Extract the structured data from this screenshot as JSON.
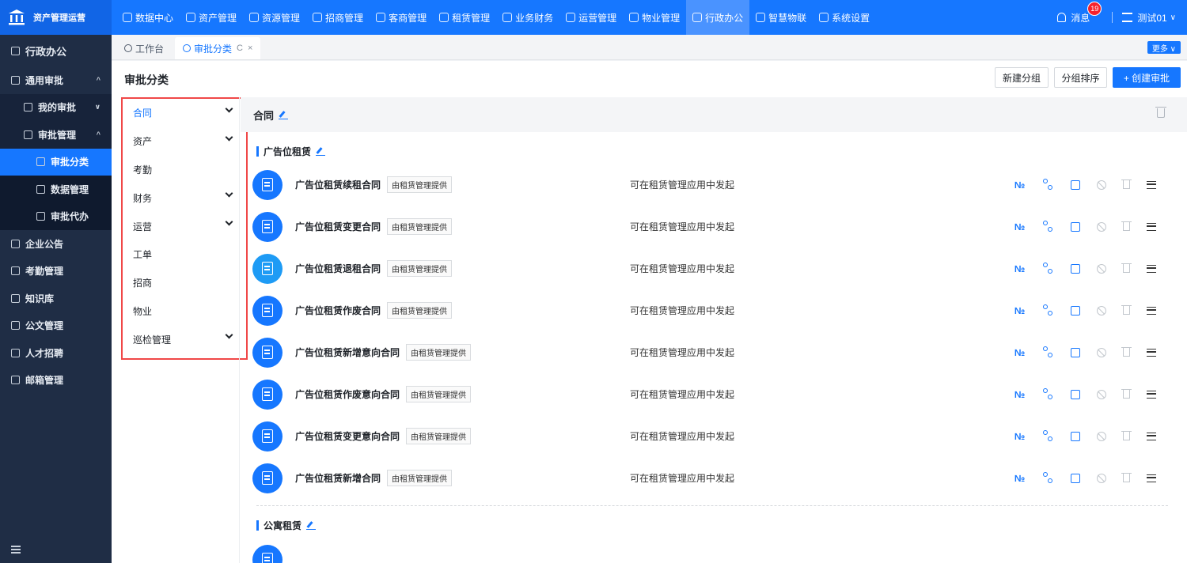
{
  "app": {
    "brand": "资产管理运营"
  },
  "topnav": [
    {
      "label": "数据中心",
      "active": false
    },
    {
      "label": "资产管理",
      "active": false
    },
    {
      "label": "资源管理",
      "active": false
    },
    {
      "label": "招商管理",
      "active": false
    },
    {
      "label": "客商管理",
      "active": false
    },
    {
      "label": "租赁管理",
      "active": false
    },
    {
      "label": "业务财务",
      "active": false
    },
    {
      "label": "运营管理",
      "active": false
    },
    {
      "label": "物业管理",
      "active": false
    },
    {
      "label": "行政办公",
      "active": true
    },
    {
      "label": "智慧物联",
      "active": false
    },
    {
      "label": "系统设置",
      "active": false
    }
  ],
  "header": {
    "messages_label": "消息",
    "messages_count": "19",
    "user_name": "测试01",
    "user_caret": "∨"
  },
  "sidebar": {
    "title": "行政办公",
    "items": [
      {
        "label": "通用审批",
        "level": 0,
        "arrow": "^"
      },
      {
        "label": "我的审批",
        "level": 1,
        "arrow": "∨"
      },
      {
        "label": "审批管理",
        "level": 1,
        "arrow": "^"
      },
      {
        "label": "审批分类",
        "level": 2,
        "selected": true
      },
      {
        "label": "数据管理",
        "level": 2
      },
      {
        "label": "审批代办",
        "level": 2
      },
      {
        "label": "企业公告",
        "level": 0
      },
      {
        "label": "考勤管理",
        "level": 0
      },
      {
        "label": "知识库",
        "level": 0
      },
      {
        "label": "公文管理",
        "level": 0
      },
      {
        "label": "人才招聘",
        "level": 0
      },
      {
        "label": "邮箱管理",
        "level": 0
      }
    ]
  },
  "tabs": {
    "items": [
      {
        "label": "工作台",
        "active": false
      },
      {
        "label": "审批分类",
        "active": true
      }
    ],
    "refresh_glyph": "C",
    "close_glyph": "×",
    "more_label": "更多 ∨"
  },
  "page": {
    "title": "审批分类",
    "buttons": {
      "new_group": "新建分组",
      "sort_group": "分组排序",
      "create": "+ 创建审批"
    }
  },
  "categories": [
    {
      "label": "合同",
      "expandable": true,
      "active": true
    },
    {
      "label": "资产",
      "expandable": true
    },
    {
      "label": "考勤",
      "expandable": false
    },
    {
      "label": "财务",
      "expandable": true
    },
    {
      "label": "运营",
      "expandable": true
    },
    {
      "label": "工单",
      "expandable": false
    },
    {
      "label": "招商",
      "expandable": false
    },
    {
      "label": "物业",
      "expandable": false
    },
    {
      "label": "巡检管理",
      "expandable": true
    }
  ],
  "group": {
    "title": "合同",
    "subgroups": [
      {
        "title": "广告位租赁",
        "items": [
          {
            "name": "广告位租赁续租合同",
            "tag": "由租赁管理提供",
            "desc": "可在租赁管理应用中发起"
          },
          {
            "name": "广告位租赁变更合同",
            "tag": "由租赁管理提供",
            "desc": "可在租赁管理应用中发起"
          },
          {
            "name": "广告位租赁退租合同",
            "tag": "由租赁管理提供",
            "desc": "可在租赁管理应用中发起"
          },
          {
            "name": "广告位租赁作废合同",
            "tag": "由租赁管理提供",
            "desc": "可在租赁管理应用中发起"
          },
          {
            "name": "广告位租赁新增意向合同",
            "tag": "由租赁管理提供",
            "desc": "可在租赁管理应用中发起"
          },
          {
            "name": "广告位租赁作废意向合同",
            "tag": "由租赁管理提供",
            "desc": "可在租赁管理应用中发起"
          },
          {
            "name": "广告位租赁变更意向合同",
            "tag": "由租赁管理提供",
            "desc": "可在租赁管理应用中发起"
          },
          {
            "name": "广告位租赁新增合同",
            "tag": "由租赁管理提供",
            "desc": "可在租赁管理应用中发起"
          }
        ]
      },
      {
        "title": "公寓租赁",
        "items": []
      }
    ],
    "action_no_glyph": "№"
  },
  "colors": {
    "primary": "#1677ff",
    "sidebar_bg": "#1f2d45",
    "highlight_border": "#f04848"
  }
}
